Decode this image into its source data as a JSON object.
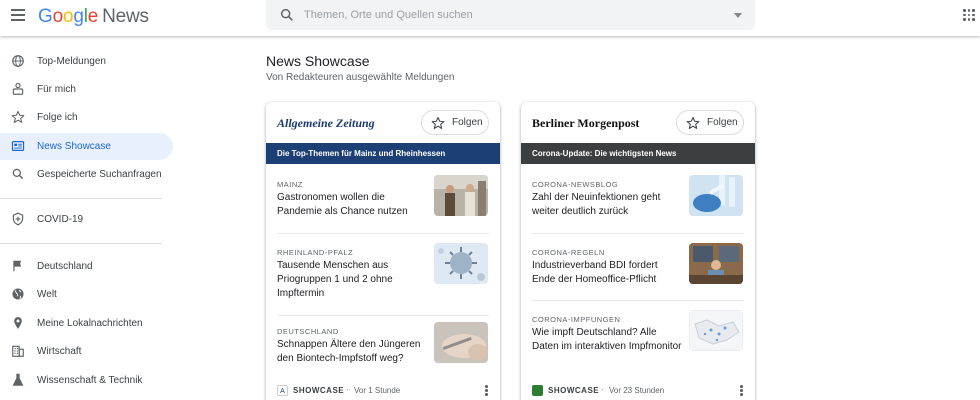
{
  "header": {
    "logo": {
      "g1": "G",
      "o1": "o",
      "o2": "o",
      "g2": "g",
      "l": "l",
      "e": "e",
      "news": "News"
    },
    "search_placeholder": "Themen, Orte und Quellen suchen"
  },
  "sidebar": {
    "items": [
      {
        "label": "Top-Meldungen",
        "icon": "globe-icon"
      },
      {
        "label": "Für mich",
        "icon": "person-icon"
      },
      {
        "label": "Folge ich",
        "icon": "star-icon"
      },
      {
        "label": "News Showcase",
        "icon": "showcase-icon",
        "active": true
      },
      {
        "label": "Gespeicherte Suchanfragen",
        "icon": "search-icon"
      },
      {
        "label": "COVID-19",
        "icon": "shield-plus-icon"
      },
      {
        "label": "Deutschland",
        "icon": "flag-icon"
      },
      {
        "label": "Welt",
        "icon": "world-icon"
      },
      {
        "label": "Meine Lokalnachrichten",
        "icon": "pin-icon"
      },
      {
        "label": "Wirtschaft",
        "icon": "building-icon"
      },
      {
        "label": "Wissenschaft & Technik",
        "icon": "flask-icon"
      }
    ]
  },
  "main": {
    "title": "News Showcase",
    "subtitle": "Von Redakteuren ausgewählte Meldungen"
  },
  "colors": {
    "accent": "#1967d2",
    "active_bg": "#e8f0fe",
    "banner_az": "#1c3f75",
    "banner_bm": "#3c3f41"
  },
  "cards": [
    {
      "publisher": "Allgemeine Zeitung",
      "follow_label": "Folgen",
      "banner": "Die Top-Themen für Mainz und Rheinhessen",
      "stories": [
        {
          "category": "MAINZ",
          "headline": "Gastronomen wollen die Pandemie als Chance nutzen"
        },
        {
          "category": "RHEINLAND-PFALZ",
          "headline": "Tausende Menschen aus Priogruppen 1 und 2 ohne Impftermin"
        },
        {
          "category": "DEUTSCHLAND",
          "headline": "Schnappen Ältere den Jüngeren den Biontech-Impfstoff weg?"
        }
      ],
      "footer": {
        "icon_letter": "A",
        "label": "SHOWCASE",
        "dot": "·",
        "time": "Vor 1 Stunde"
      }
    },
    {
      "publisher": "Berliner Morgenpost",
      "follow_label": "Folgen",
      "banner": "Corona-Update: Die wichtigsten News",
      "stories": [
        {
          "category": "CORONA-NEWSBLOG",
          "headline": "Zahl der Neuinfektionen geht weiter deutlich zurück"
        },
        {
          "category": "CORONA-REGELN",
          "headline": "Industrieverband BDI fordert Ende der Homeoffice-Pflicht"
        },
        {
          "category": "CORONA-IMPFUNGEN",
          "headline": "Wie impft Deutschland? Alle Daten im interaktiven Impfmonitor"
        }
      ],
      "footer": {
        "icon_letter": "",
        "label": "SHOWCASE",
        "dot": "·",
        "time": "Vor 23 Stunden"
      }
    }
  ]
}
